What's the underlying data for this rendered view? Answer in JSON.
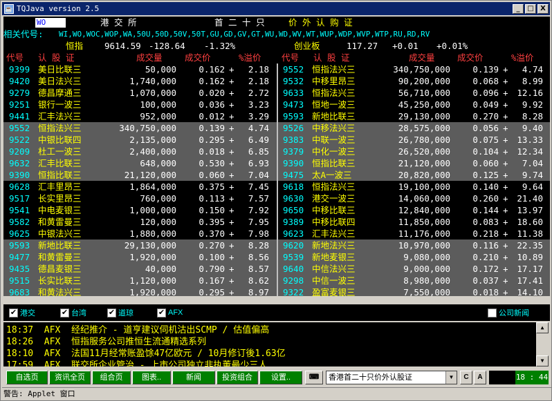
{
  "window": {
    "title": "TQJava version 2.5",
    "min": "_",
    "max": "□",
    "close": "X"
  },
  "header": {
    "input": "WO",
    "market": "港 交 所",
    "board": "首 二 十 只",
    "section": "价 外 认 购 证"
  },
  "related": {
    "label": "相关代号:",
    "codes": "WI,WO,WOC,WOP,WA,50U,50D,50V,50T,GU,GD,GV,GT,WU,WD,WV,WT,WUP,WDP,WVP,WTP,RU,RD,RV"
  },
  "indices": [
    {
      "name": "恒指",
      "value": "9614.59",
      "change": "-128.64",
      "pct": "-1.32%"
    },
    {
      "name": "创业板",
      "value": "117.27",
      "change": "+0.01",
      "pct": "+0.01%"
    }
  ],
  "columns": {
    "code": "代号",
    "name": "认 股 证",
    "volume": "成交量",
    "price": "成交价",
    "premium": "%溢价"
  },
  "left": [
    {
      "code": "9399",
      "name": "美日比联三",
      "vol": "50,000",
      "price": "0.162",
      "sign": "+",
      "prem": "2.18"
    },
    {
      "code": "9420",
      "name": "美日法兴三",
      "vol": "1,740,000",
      "price": "0.162",
      "sign": "+",
      "prem": "2.18"
    },
    {
      "code": "9279",
      "name": "德昌摩通三",
      "vol": "1,070,000",
      "price": "0.020",
      "sign": "+",
      "prem": "2.72"
    },
    {
      "code": "9251",
      "name": "银行一波三",
      "vol": "100,000",
      "price": "0.036",
      "sign": "+",
      "prem": "3.23"
    },
    {
      "code": "9441",
      "name": "汇丰法兴三",
      "vol": "952,000",
      "price": "0.012",
      "sign": "+",
      "prem": "3.29"
    },
    {
      "code": "9552",
      "name": "恒指法兴三",
      "vol": "340,750,000",
      "price": "0.139",
      "sign": "+",
      "prem": "4.74"
    },
    {
      "code": "9522",
      "name": "中银比联四",
      "vol": "2,135,000",
      "price": "0.295",
      "sign": "+",
      "prem": "6.49"
    },
    {
      "code": "9209",
      "name": "杜工一波三",
      "vol": "2,400,000",
      "price": "0.018",
      "sign": "+",
      "prem": "6.85"
    },
    {
      "code": "9632",
      "name": "汇丰比联三",
      "vol": "648,000",
      "price": "0.530",
      "sign": "+",
      "prem": "6.93"
    },
    {
      "code": "9390",
      "name": "恒指比联三",
      "vol": "21,120,000",
      "price": "0.060",
      "sign": "+",
      "prem": "7.04"
    },
    {
      "code": "9628",
      "name": "汇丰里昂三",
      "vol": "1,864,000",
      "price": "0.375",
      "sign": "+",
      "prem": "7.45"
    },
    {
      "code": "9517",
      "name": "长实里昂三",
      "vol": "760,000",
      "price": "0.113",
      "sign": "+",
      "prem": "7.57"
    },
    {
      "code": "9541",
      "name": "中电麦银三",
      "vol": "1,000,000",
      "price": "0.150",
      "sign": "+",
      "prem": "7.92"
    },
    {
      "code": "9582",
      "name": "和黄雷曼三",
      "vol": "120,000",
      "price": "0.395",
      "sign": "+",
      "prem": "7.95"
    },
    {
      "code": "9625",
      "name": "中银法兴三",
      "vol": "1,880,000",
      "price": "0.370",
      "sign": "+",
      "prem": "7.98"
    },
    {
      "code": "9593",
      "name": "新地比联三",
      "vol": "29,130,000",
      "price": "0.270",
      "sign": "+",
      "prem": "8.28"
    },
    {
      "code": "9477",
      "name": "和黄雷曼三",
      "vol": "1,920,000",
      "price": "0.100",
      "sign": "+",
      "prem": "8.56"
    },
    {
      "code": "9435",
      "name": "德昌麦银三",
      "vol": "40,000",
      "price": "0.790",
      "sign": "+",
      "prem": "8.57"
    },
    {
      "code": "9515",
      "name": "长实比联三",
      "vol": "1,120,000",
      "price": "0.167",
      "sign": "+",
      "prem": "8.62"
    },
    {
      "code": "9683",
      "name": "和黄法兴三",
      "vol": "1,920,000",
      "price": "0.295",
      "sign": "+",
      "prem": "8.97"
    }
  ],
  "right": [
    {
      "code": "9552",
      "name": "恒指法兴三",
      "vol": "340,750,000",
      "price": "0.139",
      "sign": "+",
      "prem": "4.74"
    },
    {
      "code": "9532",
      "name": "中移里昂三",
      "vol": "90,200,000",
      "price": "0.068",
      "sign": "+",
      "prem": "8.99"
    },
    {
      "code": "9633",
      "name": "恒指法兴三",
      "vol": "56,710,000",
      "price": "0.096",
      "sign": "+",
      "prem": "12.16"
    },
    {
      "code": "9473",
      "name": "恒地一波三",
      "vol": "45,250,000",
      "price": "0.049",
      "sign": "+",
      "prem": "9.92"
    },
    {
      "code": "9593",
      "name": "新地比联三",
      "vol": "29,130,000",
      "price": "0.270",
      "sign": "+",
      "prem": "8.28"
    },
    {
      "code": "9526",
      "name": "中移法兴三",
      "vol": "28,575,000",
      "price": "0.056",
      "sign": "+",
      "prem": "9.40"
    },
    {
      "code": "9383",
      "name": "中联一波三",
      "vol": "26,780,000",
      "price": "0.075",
      "sign": "+",
      "prem": "13.33"
    },
    {
      "code": "9379",
      "name": "中化一波三",
      "vol": "26,520,000",
      "price": "0.104",
      "sign": "+",
      "prem": "12.34"
    },
    {
      "code": "9390",
      "name": "恒指比联三",
      "vol": "21,120,000",
      "price": "0.060",
      "sign": "+",
      "prem": "7.04"
    },
    {
      "code": "9475",
      "name": "太A一波三",
      "vol": "20,820,000",
      "price": "0.125",
      "sign": "+",
      "prem": "9.74"
    },
    {
      "code": "9618",
      "name": "恒指法兴三",
      "vol": "19,100,000",
      "price": "0.140",
      "sign": "+",
      "prem": "9.64"
    },
    {
      "code": "9630",
      "name": "港交一波三",
      "vol": "14,060,000",
      "price": "0.260",
      "sign": "+",
      "prem": "21.40"
    },
    {
      "code": "9650",
      "name": "中移比联三",
      "vol": "12,840,000",
      "price": "0.144",
      "sign": "+",
      "prem": "13.97"
    },
    {
      "code": "9389",
      "name": "中移比联四",
      "vol": "11,850,000",
      "price": "0.083",
      "sign": "+",
      "prem": "18.60"
    },
    {
      "code": "9623",
      "name": "汇丰法兴三",
      "vol": "11,176,000",
      "price": "0.218",
      "sign": "+",
      "prem": "11.38"
    },
    {
      "code": "9620",
      "name": "新地法兴三",
      "vol": "10,970,000",
      "price": "0.116",
      "sign": "+",
      "prem": "22.35"
    },
    {
      "code": "9539",
      "name": "新地麦银三",
      "vol": "9,080,000",
      "price": "0.210",
      "sign": "+",
      "prem": "10.89"
    },
    {
      "code": "9640",
      "name": "中信法兴三",
      "vol": "9,000,000",
      "price": "0.172",
      "sign": "+",
      "prem": "17.17"
    },
    {
      "code": "9298",
      "name": "中信一波三",
      "vol": "8,980,000",
      "price": "0.037",
      "sign": "+",
      "prem": "17.41"
    },
    {
      "code": "9322",
      "name": "盈富麦银三",
      "vol": "7,550,000",
      "price": "0.018",
      "sign": "+",
      "prem": "14.10"
    }
  ],
  "filters": [
    {
      "label": "港交",
      "checked": "✔"
    },
    {
      "label": "台湾",
      "checked": "✔"
    },
    {
      "label": "道琼",
      "checked": "✔"
    },
    {
      "label": "AFX",
      "checked": "✔"
    }
  ],
  "company_news": {
    "label": "公司新闻",
    "checked": ""
  },
  "news": [
    {
      "time": "18:37",
      "src": "AFX",
      "text": "经纪推介 - 道亨建议伺机沽出SCMP / 估值偏高"
    },
    {
      "time": "18:26",
      "src": "AFX",
      "text": "恒指服务公司推恒生流通精选系列"
    },
    {
      "time": "18:10",
      "src": "AFX",
      "text": "法国11月经常账盈馀47亿欧元 / 10月修订後1.63亿"
    },
    {
      "time": "17:59",
      "src": "AFX",
      "text": "联交所企业管治 - 上市公司独立非执董最少三人"
    }
  ],
  "toolbar": {
    "buttons": [
      "自选页",
      "资讯全页",
      "组合页",
      "图表..",
      "新闻",
      "投资组合",
      "设置.."
    ],
    "select": "香港首二十只价外认股证",
    "c": "C",
    "a": "A",
    "clock": "18 : 44"
  },
  "status": "警告: Applet 窗口",
  "colors": {
    "code": "#00ffff",
    "name": "#ffff00",
    "value": "#ffffff",
    "header": "#ff4040",
    "group_bg": "#5c5c5c"
  }
}
